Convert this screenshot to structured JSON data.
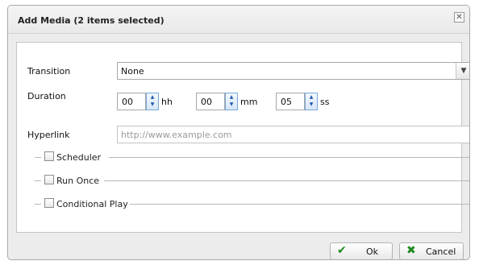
{
  "dialog": {
    "title": "Add Media (2 items selected)",
    "close_glyph": "✕",
    "close_icon": "close-icon"
  },
  "form": {
    "transition_label": "Transition",
    "transition_value": "None",
    "duration_label": "Duration",
    "hh_value": "00",
    "hh_unit": "hh",
    "mm_value": "00",
    "mm_unit": "mm",
    "ss_value": "05",
    "ss_unit": "ss",
    "hyperlink_label": "Hyperlink",
    "hyperlink_placeholder": "http://www.example.com",
    "sections": [
      "Scheduler",
      "Run Once",
      "Conditional Play"
    ]
  },
  "buttons": {
    "ok_label": "Ok",
    "cancel_label": "Cancel",
    "ok_icon": "checkmark-icon",
    "cancel_icon": "x-icon",
    "ok_color": "#1f8a1f",
    "cancel_color": "#1f8a1f"
  }
}
